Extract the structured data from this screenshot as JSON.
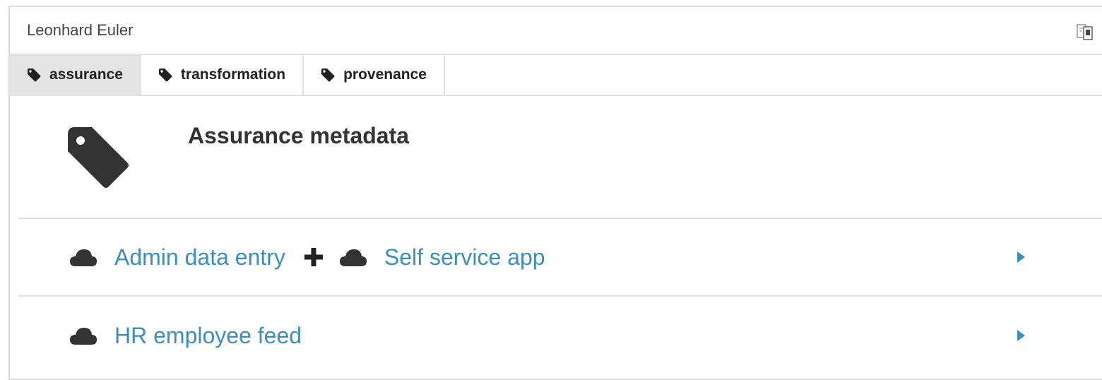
{
  "header": {
    "title": "Leonhard Euler",
    "icon": "translate-icon"
  },
  "tabs": [
    {
      "label": "assurance",
      "active": true,
      "icon": "tag-icon"
    },
    {
      "label": "transformation",
      "active": false,
      "icon": "tag-icon"
    },
    {
      "label": "provenance",
      "active": false,
      "icon": "tag-icon"
    }
  ],
  "section": {
    "title": "Assurance metadata",
    "icon": "tag-icon"
  },
  "rows": [
    {
      "items": [
        {
          "label": "Admin data entry",
          "icon": "cloud-icon"
        },
        {
          "label": "Self service app",
          "icon": "cloud-icon"
        }
      ],
      "joiner_icon": "plus-icon",
      "expand_icon": "caret-right-icon"
    },
    {
      "items": [
        {
          "label": "HR employee feed",
          "icon": "cloud-icon"
        }
      ],
      "expand_icon": "caret-right-icon"
    }
  ],
  "colors": {
    "link": "#3b8ec0",
    "icon_dark": "#333333",
    "active_tab": "#e4e4e4",
    "border": "#e2e2e2"
  }
}
